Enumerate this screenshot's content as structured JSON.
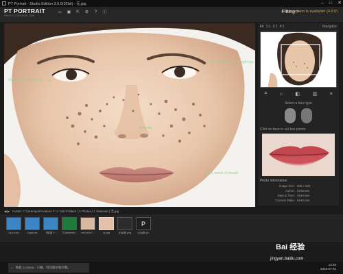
{
  "window": {
    "title": "PT Portrait - Studio Edition 3.0.0(32bit) - 无.jpg",
    "controls": [
      "–",
      "□",
      "✕"
    ]
  },
  "header": {
    "logo_title": "PT PORTRAIT",
    "logo_sub": "PHOTO-TOOLBOX.COM",
    "new_version": "A new version is available! (4.0.0)",
    "fitting_label": "Fitting >",
    "toolbar_icons": [
      "open-icon",
      "save-icon",
      "export-icon",
      "settings-icon",
      "help-icon",
      "info-icon"
    ]
  },
  "keypoints": {
    "outer_left_eye": "Outer corner of left eye",
    "outer_right_eye": "Outer corner of right eye",
    "nose_tip": "Nose tip",
    "left_mouth": "Left corner of mouth"
  },
  "right_panel": {
    "zoom_options": [
      "Fit",
      "1:1",
      "2:1",
      "4:1"
    ],
    "navigator_label": "Navigator",
    "select_face_type": "Select a face type",
    "set_keypoints": "Click on face to set key points",
    "photo_info_title": "Photo Information",
    "info": [
      {
        "k": "Image Size:",
        "v": "500 x 539"
      },
      {
        "k": "Author:",
        "v": "Unknown"
      },
      {
        "k": "Date & Time:",
        "v": "Unknown"
      },
      {
        "k": "Camera Make:",
        "v": "Unknown"
      }
    ]
  },
  "folder_bar": {
    "text": "Folder: C:\\Users\\john\\Videos # | 2 Sub-Folders | 3 Photos | 1 Selected | 无.jpg"
  },
  "filmstrip": [
    {
      "label": "Up Level",
      "kind": "folder"
    },
    {
      "label": "Captures",
      "kind": "folder"
    },
    {
      "label": "【批量下...",
      "kind": "folder"
    },
    {
      "label": "7788ebfe6d...",
      "kind": "excel"
    },
    {
      "label": "ceh7e5e7...",
      "kind": "photo"
    },
    {
      "label": "无.jpg",
      "kind": "photo"
    },
    {
      "label": "无标题.png",
      "kind": "dark"
    },
    {
      "label": "无标题.ph",
      "kind": "ptp"
    }
  ],
  "taskbar": {
    "search_text": "我是 Cortana，小娜。有问题尽管问我。",
    "clock_time": "13:35",
    "clock_date": "2018-07-01"
  },
  "watermark": {
    "brand": "Bai 经验",
    "url": "jingyan.baidu.com"
  }
}
